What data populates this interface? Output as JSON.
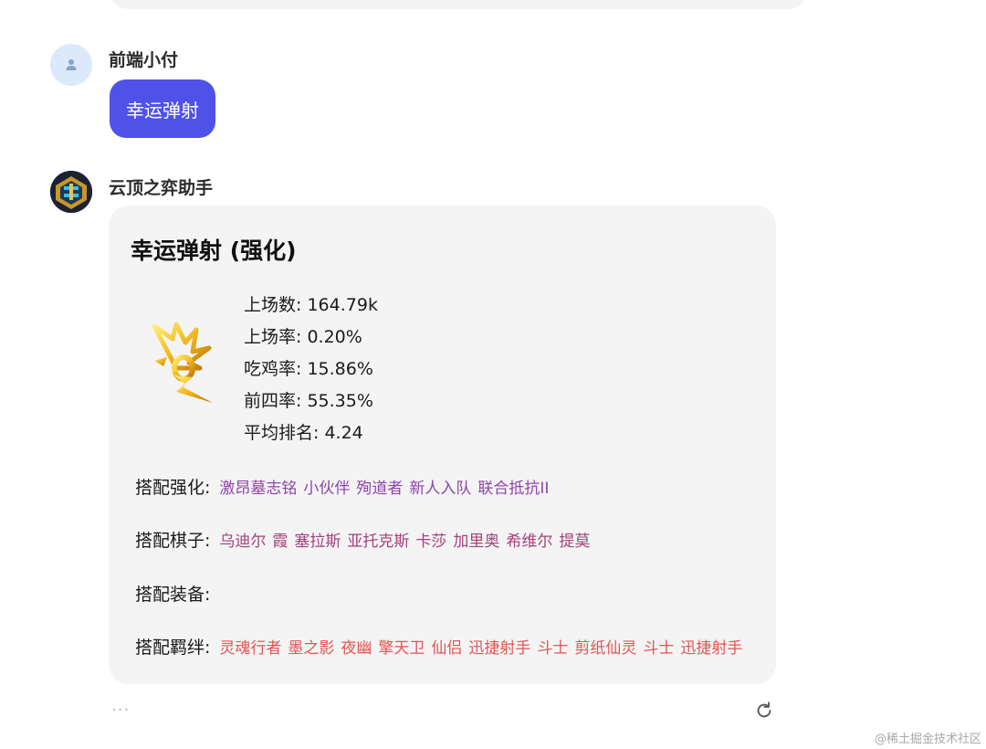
{
  "user_message": {
    "name": "前端小付",
    "text": "幸运弹射"
  },
  "bot_message": {
    "name": "云顶之弈助手",
    "card": {
      "title": "幸运弹射 (强化)",
      "stats": [
        {
          "label": "上场数",
          "value": "164.79k"
        },
        {
          "label": "上场率",
          "value": "0.20%"
        },
        {
          "label": "吃鸡率",
          "value": "15.86%"
        },
        {
          "label": "前四率",
          "value": "55.35%"
        },
        {
          "label": "平均排名",
          "value": "4.24"
        }
      ],
      "augments": {
        "label": "搭配强化:",
        "items": [
          "激昂墓志铭",
          "小伙伴",
          "殉道者",
          "新人入队",
          "联合抵抗II"
        ],
        "color": "#8e44ad"
      },
      "champions": {
        "label": "搭配棋子:",
        "items": [
          "乌迪尔",
          "霞",
          "塞拉斯",
          "亚托克斯",
          "卡莎",
          "加里奥",
          "希维尔",
          "提莫"
        ],
        "color": "#a6407a"
      },
      "items": {
        "label": "搭配装备:",
        "items": []
      },
      "traits": {
        "label": "搭配羁绊:",
        "items": [
          "灵魂行者",
          "墨之影",
          "夜幽",
          "擎天卫",
          "仙侣",
          "迅捷射手",
          "斗士",
          "剪纸仙灵",
          "斗士",
          "迅捷射手"
        ],
        "color": "#e25454"
      }
    }
  },
  "actions": {
    "more_label": "···",
    "refresh_icon": "refresh-icon"
  },
  "watermark": "@稀土掘金技术社区",
  "colors": {
    "user_bubble": "#4f52e8",
    "card_bg": "#f4f4f4"
  }
}
